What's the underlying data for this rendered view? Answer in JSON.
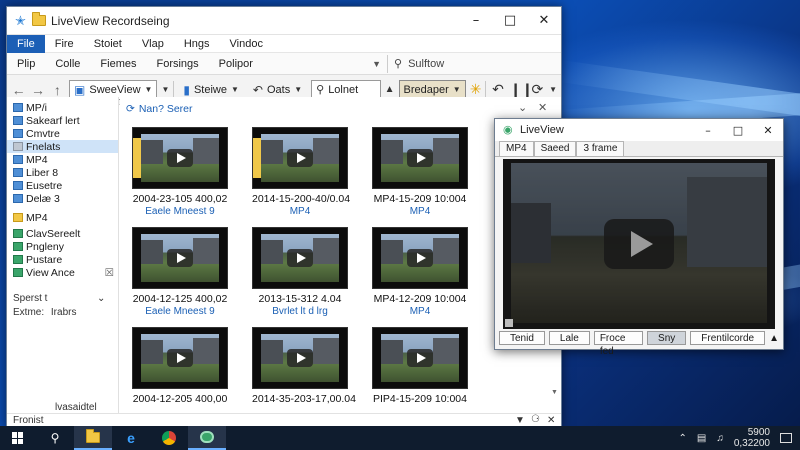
{
  "explorer": {
    "title": "LiveView Recordseing",
    "menu": [
      "File",
      "Fire",
      "Stoiet",
      "Vlap",
      "Hngs",
      "Vindoc"
    ],
    "ribbon": [
      "Plip",
      "Colle",
      "Fiemes",
      "Forsings",
      "Polipor"
    ],
    "ribbon_search": "Sulftow",
    "toolbar": {
      "view_label": "SweeView",
      "share_label": "Steiwe",
      "cast_label": "Oats",
      "lolnet_label": "Lolnet",
      "bredaper_label": "Bredaper"
    },
    "sidebar": {
      "items": [
        {
          "label": "MP/i",
          "icon": "computer"
        },
        {
          "label": "Sakearf lert",
          "icon": "blue"
        },
        {
          "label": "Cmvtre",
          "icon": "blue"
        },
        {
          "label": "Fnelats",
          "icon": "gray",
          "selected": true
        },
        {
          "label": "MP4",
          "icon": "blue"
        },
        {
          "label": "Liber 8",
          "icon": "blue"
        },
        {
          "label": "Eusetre",
          "icon": "blue"
        },
        {
          "label": "Delæ 3",
          "icon": "blue"
        },
        {
          "label": "MP4",
          "icon": "yellow"
        },
        {
          "label": "ClavSereelt",
          "icon": "green"
        },
        {
          "label": "Pngleny",
          "icon": "green"
        },
        {
          "label": "Pustare",
          "icon": "green"
        },
        {
          "label": "View Ance",
          "icon": "green"
        }
      ],
      "status1": "Sperst t",
      "status2": "Extme:",
      "status2b": "Irabrs"
    },
    "breadcrumb": "Nan? Serer",
    "thumbnails": [
      {
        "name": "2004-23-105 400,02",
        "sub": "Eaele Mneest 9"
      },
      {
        "name": "2014-15-200-40/0.04",
        "sub": "MP4"
      },
      {
        "name": "MP4-15-209 10:004",
        "sub": "MP4"
      },
      {
        "name": "2004-12-125 400,02",
        "sub": "Eaele Mneest 9"
      },
      {
        "name": "2013-15-312 4.04",
        "sub": "Bvrlet lt d lrg"
      },
      {
        "name": "MP4-12-209 10:004",
        "sub": "MP4"
      },
      {
        "name": "2004-12-205 400,00",
        "sub": ""
      },
      {
        "name": "2014-35-203-17,00.04",
        "sub": ""
      },
      {
        "name": "PIP4-15-209 10:004",
        "sub": ""
      }
    ],
    "status_left": "Fronist",
    "status_right": "lvasaidtel"
  },
  "liveview": {
    "title": "LiveView",
    "tabs": [
      "MP4",
      "Saeed",
      "3 frame"
    ],
    "controls": [
      "Tenid",
      "Lale",
      "Froce fed",
      "Sny",
      "Frentilcorde"
    ]
  },
  "taskbar": {
    "time": "5900",
    "date": "0,32200"
  }
}
